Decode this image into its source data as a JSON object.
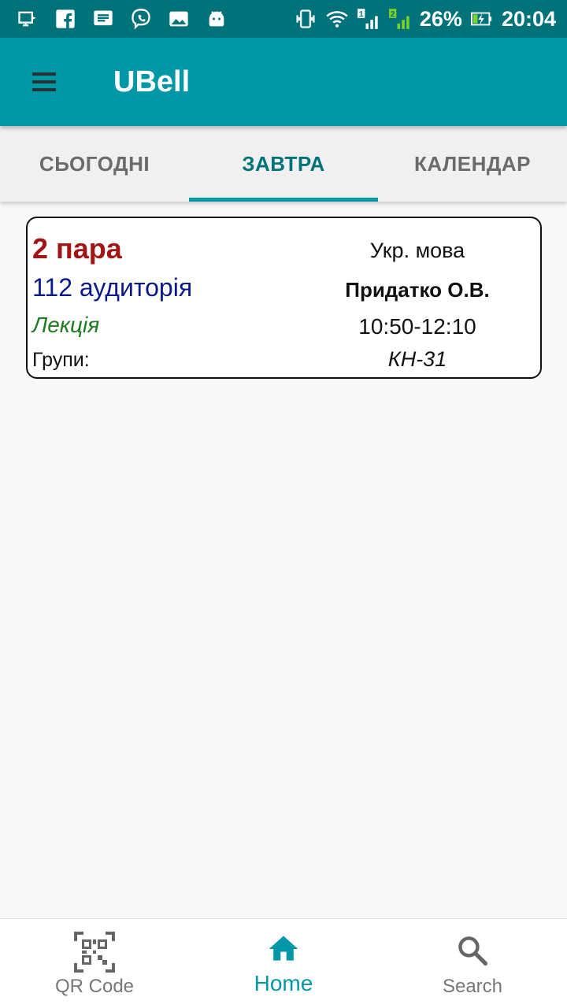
{
  "status_bar": {
    "battery_percent": "26%",
    "time": "20:04",
    "sim1_label": "1",
    "sim2_label": "2",
    "icons": [
      "screen-share-icon",
      "facebook-icon",
      "message-icon",
      "viber-icon",
      "gallery-icon",
      "android-icon",
      "vibrate-icon",
      "wifi-icon",
      "signal-sim1-icon",
      "signal-sim2-icon",
      "battery-charging-icon"
    ]
  },
  "app_bar": {
    "title": "UBell",
    "menu_icon": "menu-icon",
    "color": "#0097a7"
  },
  "tabs": [
    {
      "label": "СЬОГОДНІ",
      "active": false
    },
    {
      "label": "ЗАВТРА",
      "active": true
    },
    {
      "label": "КАЛЕНДАР",
      "active": false
    }
  ],
  "lessons": [
    {
      "number": "2 пара",
      "room": "112 аудиторія",
      "type": "Лекція",
      "groups_label": "Групи:",
      "subject": "Укр. мова",
      "teacher": "Придатко О.В.",
      "time": "10:50-12:10",
      "groups": "КН-31"
    }
  ],
  "bottom_nav": [
    {
      "label": "QR Code",
      "icon": "qr-code-icon",
      "active": false
    },
    {
      "label": "Home",
      "icon": "home-icon",
      "active": true
    },
    {
      "label": "Search",
      "icon": "search-icon",
      "active": false
    }
  ],
  "colors": {
    "status_bar": "#00727a",
    "accent": "#0097a7",
    "lesson_number": "#a31515",
    "room": "#0a1a8c",
    "lesson_type": "#1e7a1e"
  }
}
